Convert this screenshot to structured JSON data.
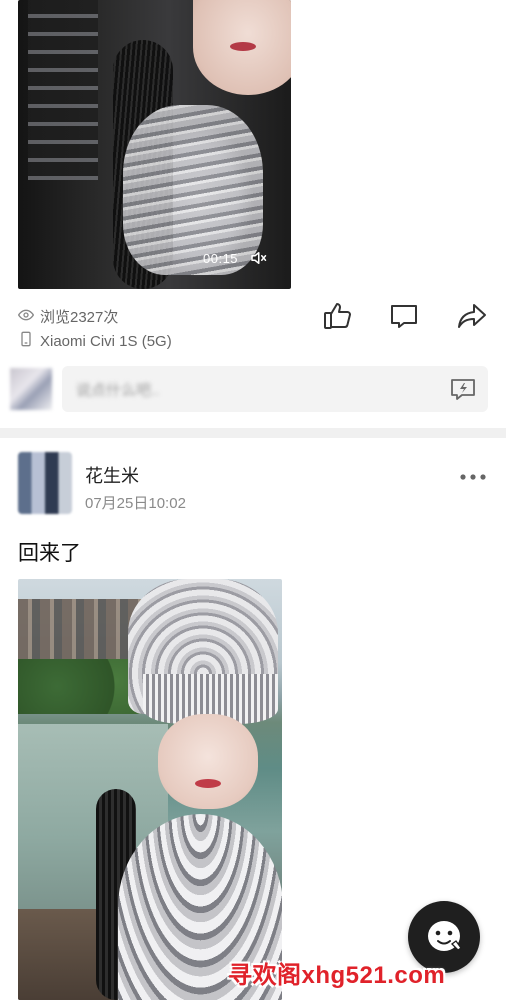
{
  "post_top": {
    "video_duration": "00:15",
    "views_text": "浏览2327次",
    "device_text": "Xiaomi Civi 1S (5G)",
    "actions": {
      "like_icon": "thumbs-up-icon",
      "comment_icon": "comment-bubble-icon",
      "share_icon": "share-arrow-icon"
    }
  },
  "comment_bar": {
    "placeholder": "说点什么吧..",
    "quick_icon": "quick-reply-icon"
  },
  "post_bottom": {
    "username": "花生米",
    "time": "07月25日10:02",
    "text": "回来了",
    "more_icon": "more-dots-icon"
  },
  "floating_button": {
    "icon": "mascot-face-icon"
  },
  "watermark": {
    "text": "寻欢阁xhg521.com",
    "color": "#e0222a"
  }
}
